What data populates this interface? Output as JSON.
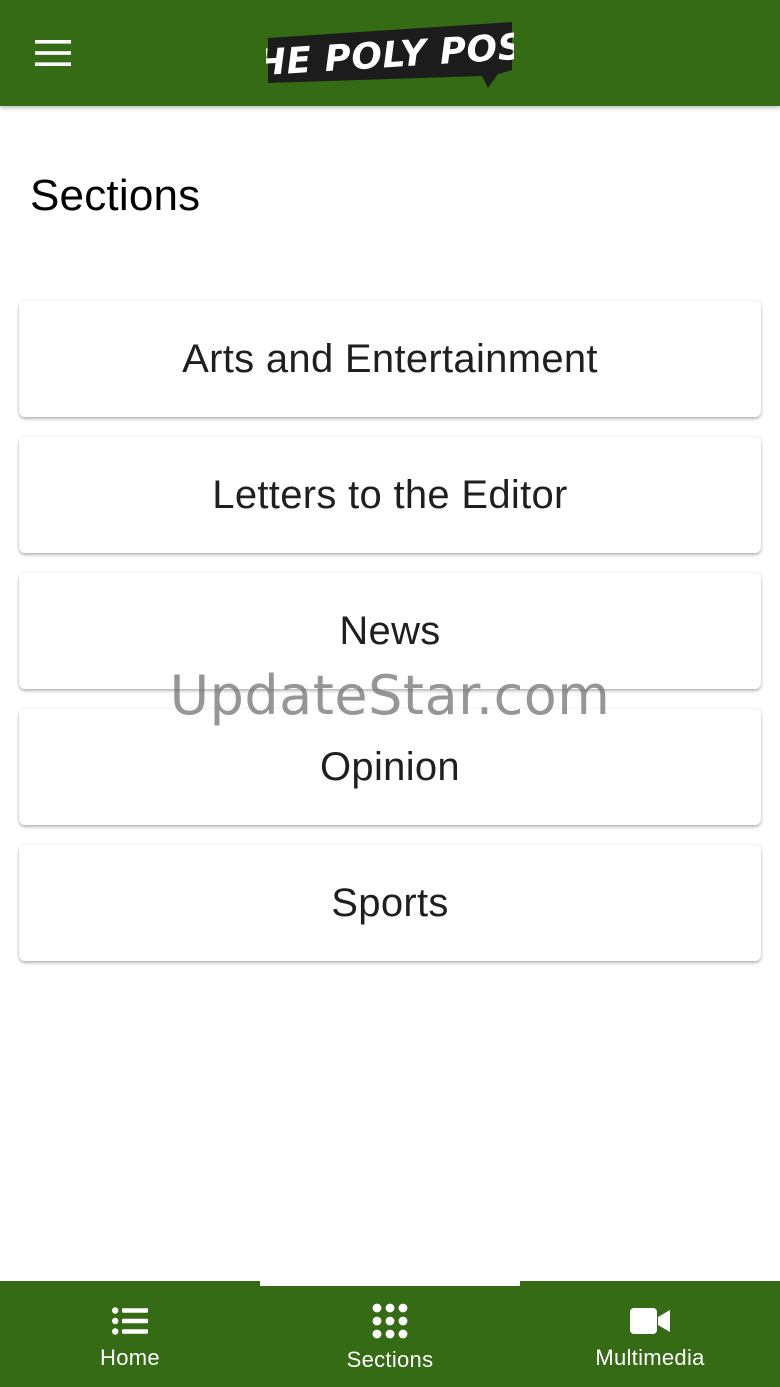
{
  "header": {
    "menu_icon": "hamburger-menu-icon",
    "logo_text": "THE POLY POST"
  },
  "main": {
    "title": "Sections",
    "sections": [
      {
        "label": "Arts and Entertainment"
      },
      {
        "label": "Letters to the Editor"
      },
      {
        "label": "News"
      },
      {
        "label": "Opinion"
      },
      {
        "label": "Sports"
      }
    ]
  },
  "watermark": "UpdateStar.com",
  "bottom_nav": {
    "tabs": [
      {
        "label": "Home",
        "icon": "list-icon",
        "active": false
      },
      {
        "label": "Sections",
        "icon": "grid-dots-icon",
        "active": true
      },
      {
        "label": "Multimedia",
        "icon": "video-camera-icon",
        "active": false
      }
    ]
  },
  "colors": {
    "brand_green": "#346b14",
    "card_text": "#1f1f1f",
    "background": "#ffffff"
  }
}
